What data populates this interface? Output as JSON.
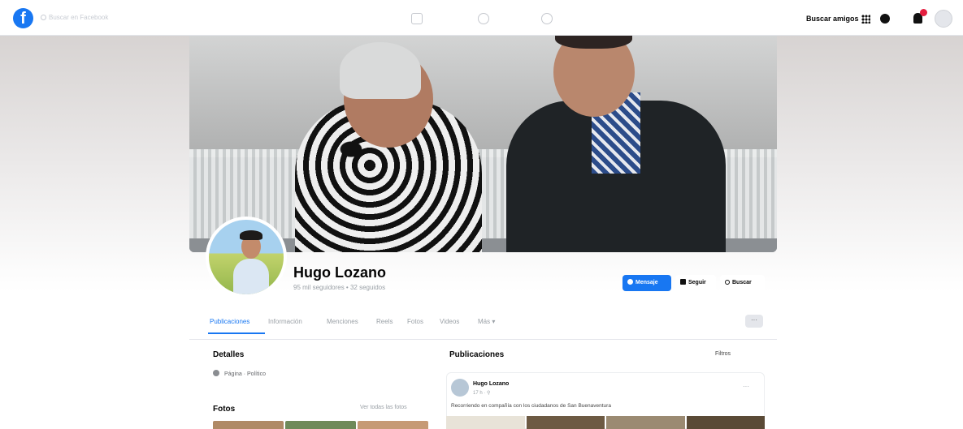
{
  "topbar": {
    "logo": "f",
    "search_placeholder": "Buscar en Facebook",
    "find_friends_label": "Buscar amigos",
    "icons": [
      "home-icon",
      "friends-icon",
      "groups-icon",
      "menu-grid-icon",
      "messenger-icon",
      "bell-icon"
    ]
  },
  "profile": {
    "name": "Hugo Lozano",
    "followers": "95 mil seguidores • 32 seguidos",
    "buttons": {
      "message": "Mensaje",
      "follow": "Seguir",
      "search": "Buscar"
    }
  },
  "tabs": [
    {
      "label": "Publicaciones",
      "active": true
    },
    {
      "label": "Información"
    },
    {
      "label": "Menciones"
    },
    {
      "label": "Reels"
    },
    {
      "label": "Fotos"
    },
    {
      "label": "Videos"
    },
    {
      "label": "Más ▾"
    }
  ],
  "tabs_more": "···",
  "details": {
    "title": "Detalles",
    "page_type": "Página · Político"
  },
  "photos": {
    "title": "Fotos",
    "see_all": "Ver todas las fotos"
  },
  "posts": {
    "title": "Publicaciones",
    "filters_label": "Filtros",
    "first_post": {
      "author": "Hugo Lozano",
      "time": "17 h · ⚲",
      "more": "···",
      "text": "Recorriendo en compañía con los ciudadanos de San Buenaventura"
    }
  },
  "colors": {
    "accent": "#1877f2",
    "notification": "#e41e3f"
  }
}
